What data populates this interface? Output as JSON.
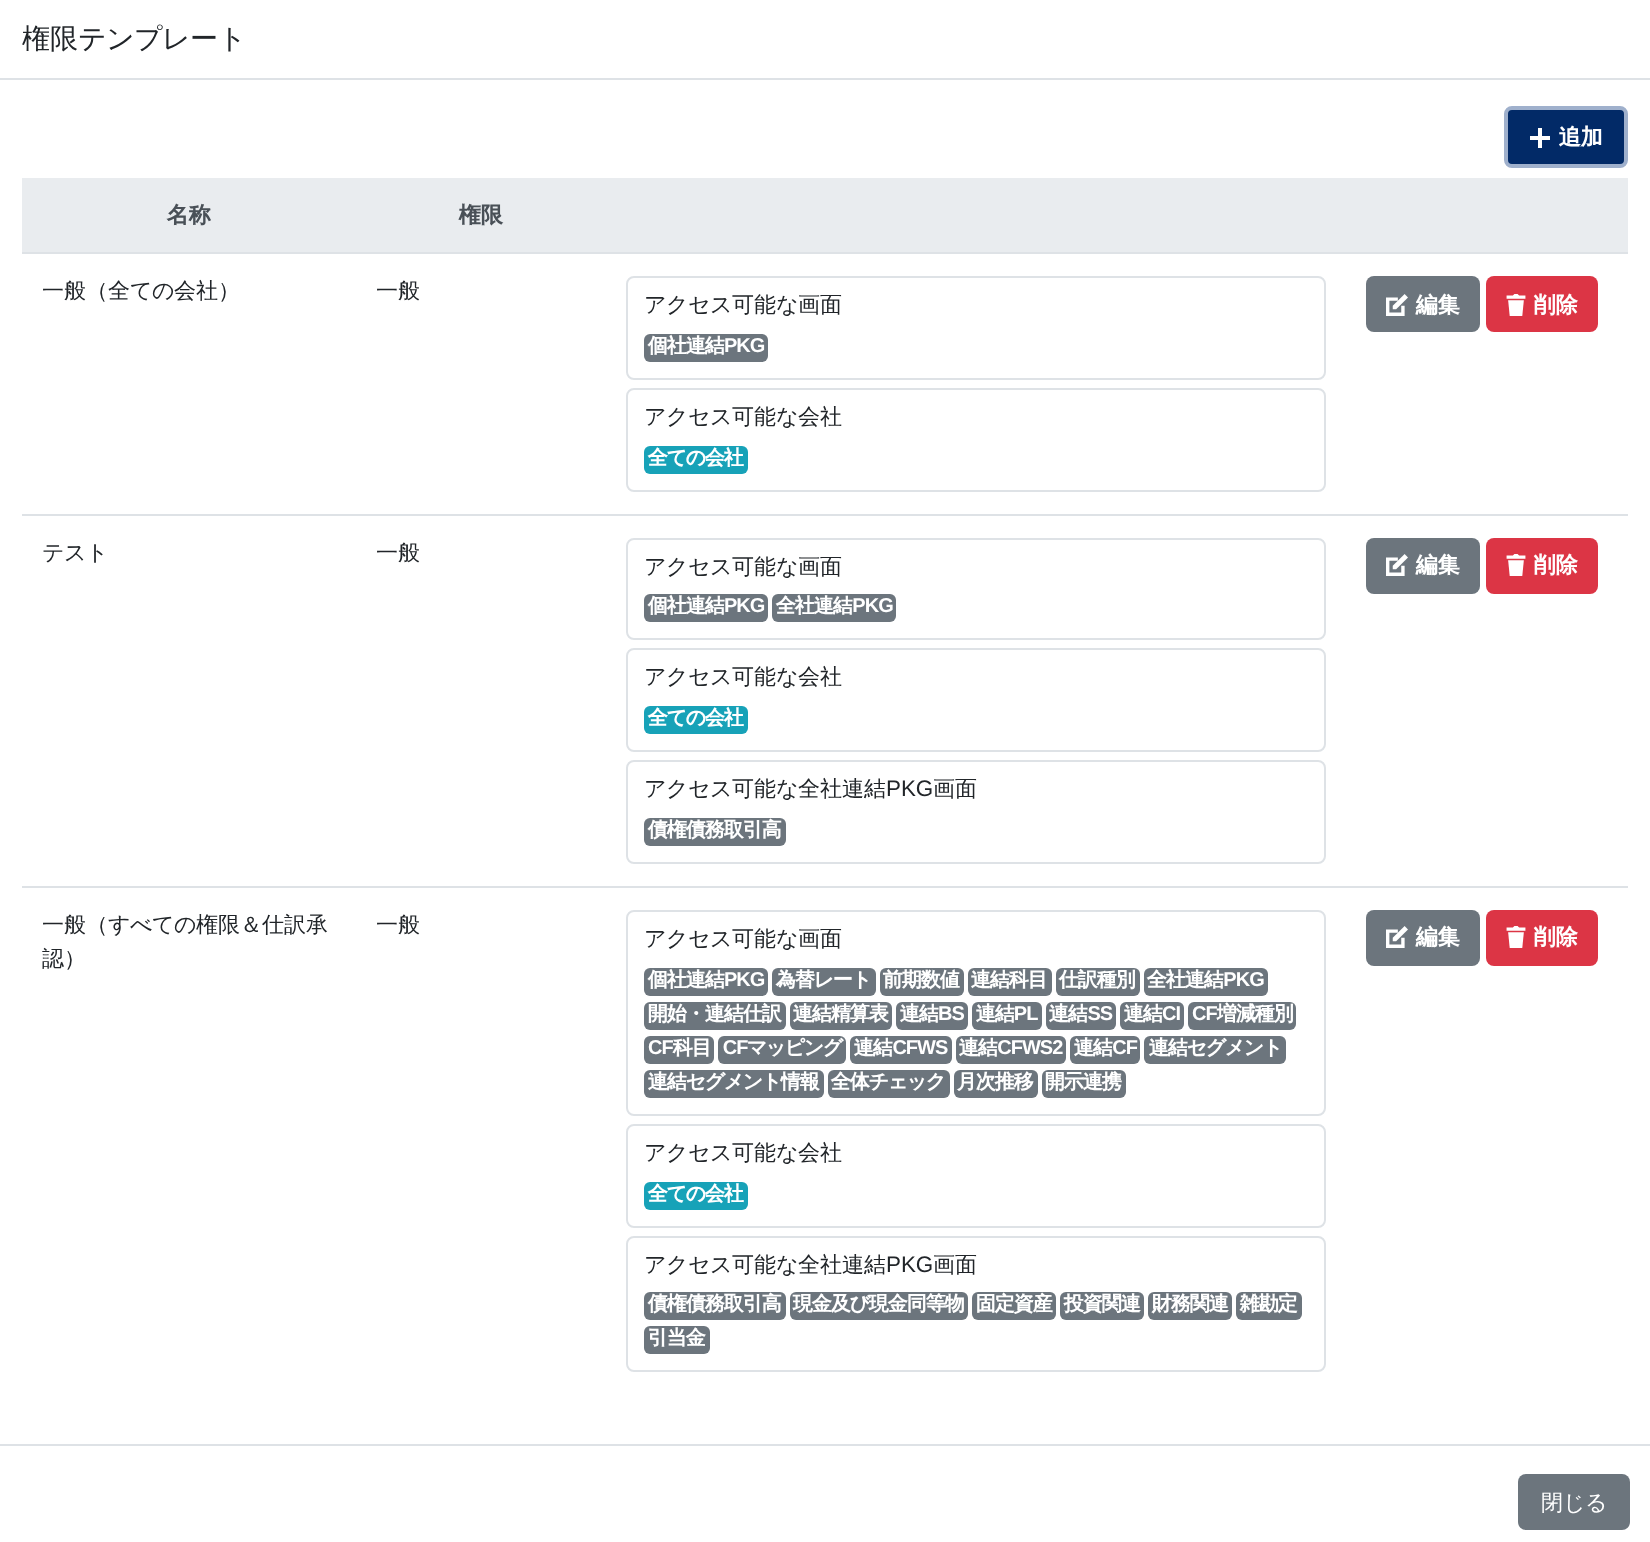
{
  "modal": {
    "title": "権限テンプレート"
  },
  "toolbar": {
    "add_button": {
      "label": "追加"
    }
  },
  "table": {
    "columns": [
      "名称",
      "権限"
    ],
    "rows": [
      {
        "name": "一般（全ての会社）",
        "permission": "一般",
        "sections": [
          {
            "title": "アクセス可能な画面",
            "badges": [
              {
                "label": "個社連結PKG",
                "color": "#6c757d"
              }
            ]
          },
          {
            "title": "アクセス可能な会社",
            "badges": [
              {
                "label": "全ての会社",
                "color": "#17a2b8"
              }
            ]
          }
        ],
        "actions": [
          {
            "kind": "edit",
            "label": "編集"
          },
          {
            "kind": "delete",
            "label": "削除"
          }
        ]
      },
      {
        "name": "テスト",
        "permission": "一般",
        "sections": [
          {
            "title": "アクセス可能な画面",
            "badges": [
              {
                "label": "個社連結PKG",
                "color": "#6c757d"
              },
              {
                "label": "全社連結PKG",
                "color": "#6c757d"
              }
            ]
          },
          {
            "title": "アクセス可能な会社",
            "badges": [
              {
                "label": "全ての会社",
                "color": "#17a2b8"
              }
            ]
          },
          {
            "title": "アクセス可能な全社連結PKG画面",
            "badges": [
              {
                "label": "債権債務取引高",
                "color": "#6c757d"
              }
            ]
          }
        ],
        "actions": [
          {
            "kind": "edit",
            "label": "編集"
          },
          {
            "kind": "delete",
            "label": "削除"
          }
        ]
      },
      {
        "name": "一般（すべての権限＆仕訳承認）",
        "permission": "一般",
        "sections": [
          {
            "title": "アクセス可能な画面",
            "badges": [
              {
                "label": "個社連結PKG",
                "color": "#6c757d"
              },
              {
                "label": "為替レート",
                "color": "#6c757d"
              },
              {
                "label": "前期数値",
                "color": "#6c757d"
              },
              {
                "label": "連結科目",
                "color": "#6c757d"
              },
              {
                "label": "仕訳種別",
                "color": "#6c757d"
              },
              {
                "label": "全社連結PKG",
                "color": "#6c757d"
              },
              {
                "label": "開始・連結仕訳",
                "color": "#6c757d"
              },
              {
                "label": "連結精算表",
                "color": "#6c757d"
              },
              {
                "label": "連結BS",
                "color": "#6c757d"
              },
              {
                "label": "連結PL",
                "color": "#6c757d"
              },
              {
                "label": "連結SS",
                "color": "#6c757d"
              },
              {
                "label": "連結CI",
                "color": "#6c757d"
              },
              {
                "label": "CF増減種別",
                "color": "#6c757d"
              },
              {
                "label": "CF科目",
                "color": "#6c757d"
              },
              {
                "label": "CFマッピング",
                "color": "#6c757d"
              },
              {
                "label": "連結CFWS",
                "color": "#6c757d"
              },
              {
                "label": "連結CFWS2",
                "color": "#6c757d"
              },
              {
                "label": "連結CF",
                "color": "#6c757d"
              },
              {
                "label": "連結セグメント",
                "color": "#6c757d"
              },
              {
                "label": "連結セグメント情報",
                "color": "#6c757d"
              },
              {
                "label": "全体チェック",
                "color": "#6c757d"
              },
              {
                "label": "月次推移",
                "color": "#6c757d"
              },
              {
                "label": "開示連携",
                "color": "#6c757d"
              }
            ]
          },
          {
            "title": "アクセス可能な会社",
            "badges": [
              {
                "label": "全ての会社",
                "color": "#17a2b8"
              }
            ]
          },
          {
            "title": "アクセス可能な全社連結PKG画面",
            "badges": [
              {
                "label": "債権債務取引高",
                "color": "#6c757d"
              },
              {
                "label": "現金及び現金同等物",
                "color": "#6c757d"
              },
              {
                "label": "固定資産",
                "color": "#6c757d"
              },
              {
                "label": "投資関連",
                "color": "#6c757d"
              },
              {
                "label": "財務関連",
                "color": "#6c757d"
              },
              {
                "label": "雑勘定",
                "color": "#6c757d"
              },
              {
                "label": "引当金",
                "color": "#6c757d"
              }
            ]
          }
        ],
        "actions": [
          {
            "kind": "edit",
            "label": "編集"
          },
          {
            "kind": "delete",
            "label": "削除"
          }
        ]
      }
    ]
  },
  "footer": {
    "close_button": {
      "label": "閉じる"
    }
  }
}
